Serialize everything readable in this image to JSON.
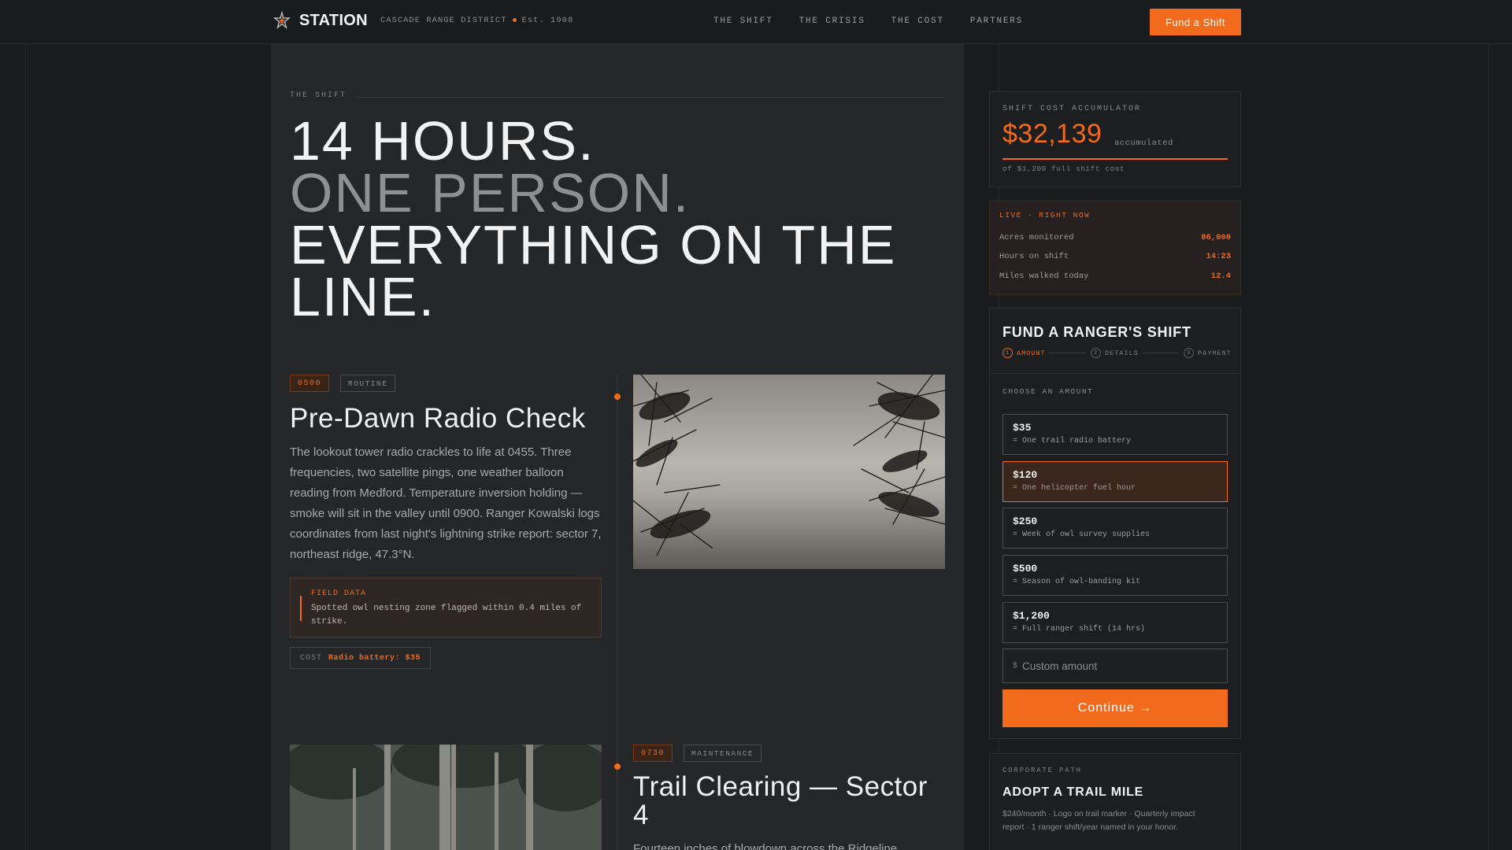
{
  "nav": {
    "brand": "STATION",
    "district": "CASCADE RANGE DISTRICT",
    "est": "Est. 1908",
    "links": [
      "THE SHIFT",
      "THE CRISIS",
      "THE COST",
      "PARTNERS"
    ],
    "cta": "Fund a Shift"
  },
  "main": {
    "section_label": "THE SHIFT",
    "hero": [
      "14 HOURS.",
      "ONE PERSON.",
      "EVERYTHING ON THE",
      "LINE."
    ],
    "entry1": {
      "time": "0500",
      "kind": "ROUTINE",
      "title": "Pre-Dawn Radio Check",
      "body": "The lookout tower radio crackles to life at 0455. Three frequencies, two satellite pings, one weather balloon reading from Medford. Temperature inversion holding — smoke will sit in the valley until 0900. Ranger Kowalski logs coordinates from last night's lightning strike report: sector 7, northeast ridge, 47.3°N.",
      "field_label": "FIELD DATA",
      "field_text": "Spotted owl nesting zone flagged within 0.4 miles of strike.",
      "cost_key": "COST",
      "cost_val": "Radio battery: $35"
    },
    "entry2": {
      "time": "0730",
      "kind": "MAINTENANCE",
      "title": "Trail Clearing — Sector 4",
      "body": "Fourteen inches of blowdown across the Ridgeline"
    }
  },
  "accumulator": {
    "label": "SHIFT COST ACCUMULATOR",
    "amount": "$32,139",
    "suffix": "accumulated",
    "note": "of $1,200 full shift cost"
  },
  "live": {
    "head": "LIVE · RIGHT NOW",
    "rows": [
      {
        "k": "Acres monitored",
        "v": "86,000"
      },
      {
        "k": "Hours on shift",
        "v": "14:23"
      },
      {
        "k": "Miles walked today",
        "v": "12.4"
      }
    ]
  },
  "fund": {
    "title": "FUND A RANGER'S SHIFT",
    "steps": [
      {
        "n": "1",
        "label": "AMOUNT"
      },
      {
        "n": "2",
        "label": "DETAILS"
      },
      {
        "n": "3",
        "label": "PAYMENT"
      }
    ],
    "choose_label": "CHOOSE AN AMOUNT",
    "amounts": [
      {
        "value": "$35",
        "desc": "= One trail radio battery"
      },
      {
        "value": "$120",
        "desc": "= One helicopter fuel hour"
      },
      {
        "value": "$250",
        "desc": "= Week of owl survey supplies"
      },
      {
        "value": "$500",
        "desc": "= Season of owl-banding kit"
      },
      {
        "value": "$1,200",
        "desc": "= Full ranger shift (14 hrs)"
      }
    ],
    "selected_index": 1,
    "custom_currency": "$",
    "custom_placeholder": "Custom amount",
    "continue": "Continue →"
  },
  "corporate": {
    "label": "CORPORATE PATH",
    "title": "ADOPT A TRAIL MILE",
    "text": "$240/month · Logo on trail marker · Quarterly impact report · 1 ranger shift/year named in your honor."
  },
  "colors": {
    "accent": "#f26a1b",
    "bg": "#1b1c1e",
    "panel": "#252628"
  },
  "icons": {
    "brand": "lookout-star-icon",
    "arrow": "arrow-right-icon"
  }
}
